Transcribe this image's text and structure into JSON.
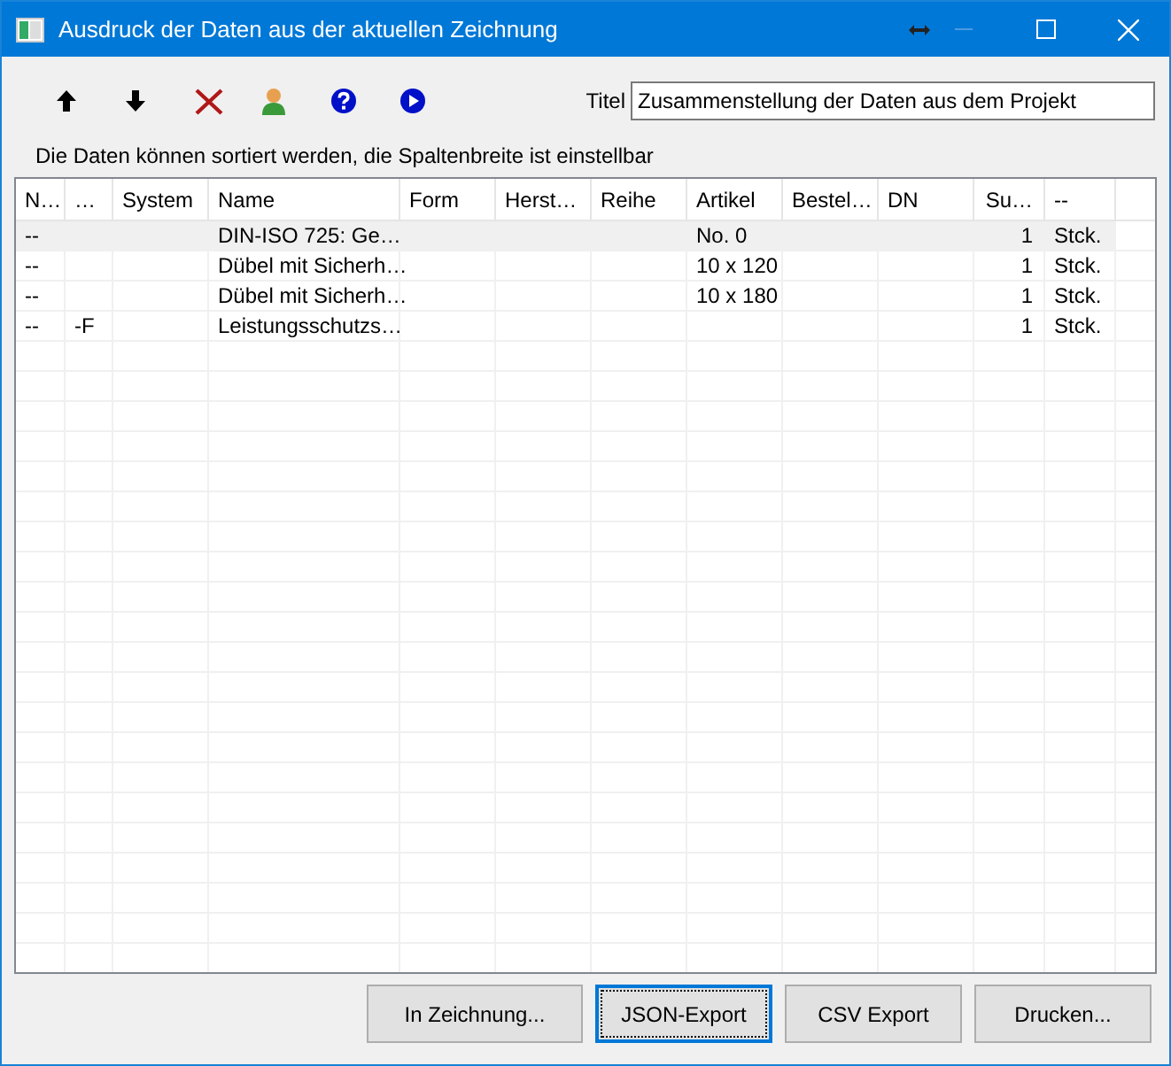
{
  "window": {
    "title": "Ausdruck der Daten aus der aktuellen Zeichnung",
    "minimize_disabled": true
  },
  "toolbar": {
    "title_label": "Titel",
    "title_value": "Zusammenstellung der Daten aus dem Projekt"
  },
  "hint": "Die Daten können sortiert werden, die Spaltenbreite ist einstellbar",
  "table": {
    "columns": [
      "N…",
      "…",
      "System",
      "Name",
      "Form",
      "Herst…",
      "Reihe",
      "Artikel",
      "Bestel…",
      "DN",
      "Su…",
      "--"
    ],
    "rows": [
      {
        "selected": true,
        "cells": [
          "--",
          "",
          "",
          "DIN-ISO 725: Ge…",
          "",
          "",
          "",
          "No. 0",
          "",
          "",
          "1",
          "Stck."
        ]
      },
      {
        "selected": false,
        "cells": [
          "--",
          "",
          "",
          "Dübel mit Sicherh…",
          "",
          "",
          "",
          "10 x 120",
          "",
          "",
          "1",
          "Stck."
        ]
      },
      {
        "selected": false,
        "cells": [
          "--",
          "",
          "",
          "Dübel mit Sicherh…",
          "",
          "",
          "",
          "10 x 180",
          "",
          "",
          "1",
          "Stck."
        ]
      },
      {
        "selected": false,
        "cells": [
          "--",
          "-F",
          "",
          "Leistungsschutzs…",
          "",
          "",
          "",
          "",
          "",
          "",
          "1",
          "Stck."
        ]
      }
    ]
  },
  "buttons": [
    {
      "label": "In Zeichnung...",
      "focused": false
    },
    {
      "label": "JSON-Export",
      "focused": true
    },
    {
      "label": "CSV Export",
      "focused": false
    },
    {
      "label": "Drucken...",
      "focused": false
    }
  ]
}
